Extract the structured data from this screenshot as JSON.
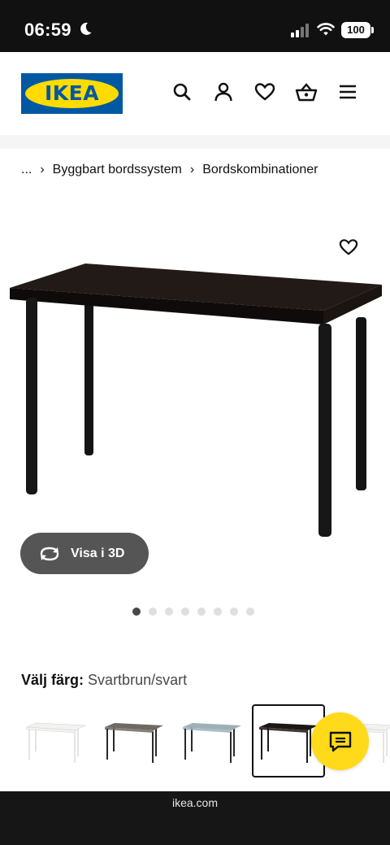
{
  "status_bar": {
    "time": "06:59",
    "battery": "100",
    "icons": [
      "moon-icon",
      "cellular-signal-icon",
      "wifi-icon",
      "battery-icon"
    ]
  },
  "header": {
    "logo_text": "IKEA",
    "icons": [
      "search-icon",
      "profile-icon",
      "heart-icon",
      "basket-icon",
      "menu-icon"
    ],
    "brand_colors": {
      "blue": "#0058a3",
      "yellow": "#ffdb00"
    }
  },
  "breadcrumb": {
    "ellipsis": "...",
    "separator": "›",
    "items": [
      "Byggbart bordssystem",
      "Bordskombinationer"
    ]
  },
  "product": {
    "image_icon": "desk-image",
    "favorite_icon": "heart-icon",
    "view_3d_label": "Visa i 3D",
    "carousel": {
      "count": 8,
      "active_index": 0
    }
  },
  "color_selector": {
    "label": "Välj färg:",
    "value": "Svartbrun/svart",
    "options": [
      {
        "name": "white",
        "top": "#f2f2f0",
        "legs": "#e4e4e4"
      },
      {
        "name": "gray-black",
        "top": "#6e6962",
        "legs": "#2a2a2a"
      },
      {
        "name": "blue-gray",
        "top": "#9db0b6",
        "legs": "#2a2a2a"
      },
      {
        "name": "black-brown",
        "top": "#1c1614",
        "legs": "#1c1c1c"
      },
      {
        "name": "white-2",
        "top": "#f2f2f0",
        "legs": "#e4e4e4"
      }
    ],
    "selected_index": 3
  },
  "chat": {
    "icon": "chat-icon",
    "color": "#ffda1a"
  },
  "browser": {
    "url": "ikea.com"
  }
}
